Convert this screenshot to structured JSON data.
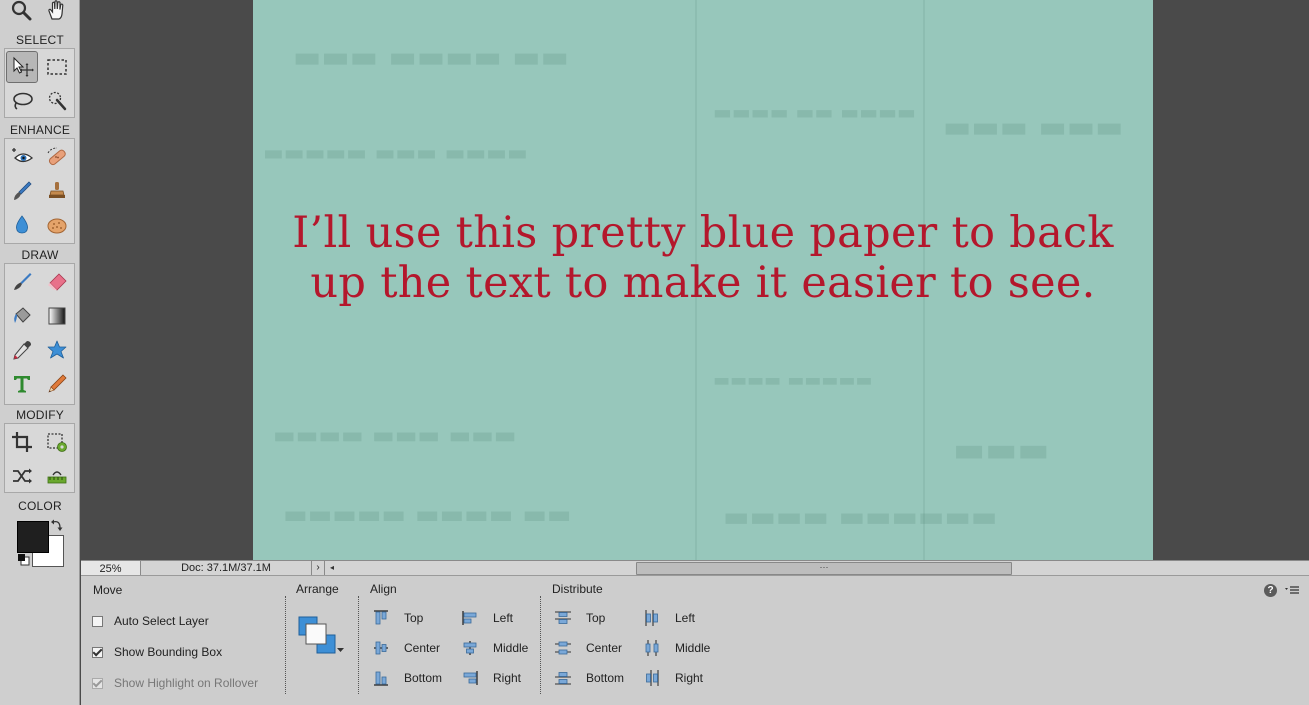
{
  "toolbox": {
    "sections": {
      "select": "SELECT",
      "enhance": "ENHANCE",
      "draw": "DRAW",
      "modify": "MODIFY",
      "color": "COLOR"
    },
    "foreground_color": "#1f1f1f",
    "background_color": "#ffffff",
    "active_tool": "move-tool"
  },
  "canvas": {
    "paper_color": "#97c7bb",
    "text_color": "#b4172c",
    "text_lines": [
      "I’ll use this pretty blue paper to back",
      "up the text to make it easier to see."
    ]
  },
  "statusbar": {
    "zoom": "25%",
    "doc_info": "Doc: 37.1M/37.1M",
    "menu_arrow": "›",
    "scroll_left_arrow": "◂",
    "scroll_thumb_grip": "⋯"
  },
  "options": {
    "move_title": "Move",
    "checkboxes": [
      {
        "label": "Auto Select Layer",
        "checked": false,
        "enabled": true
      },
      {
        "label": "Show Bounding Box",
        "checked": true,
        "enabled": true
      },
      {
        "label": "Show Highlight on Rollover",
        "checked": true,
        "enabled": false
      }
    ],
    "arrange_title": "Arrange",
    "align_title": "Align",
    "align_vertical": [
      "Top",
      "Center",
      "Bottom"
    ],
    "align_horizontal": [
      "Left",
      "Middle",
      "Right"
    ],
    "distribute_title": "Distribute",
    "distribute_vertical": [
      "Top",
      "Center",
      "Bottom"
    ],
    "distribute_horizontal": [
      "Left",
      "Middle",
      "Right"
    ],
    "help_label": "?"
  }
}
